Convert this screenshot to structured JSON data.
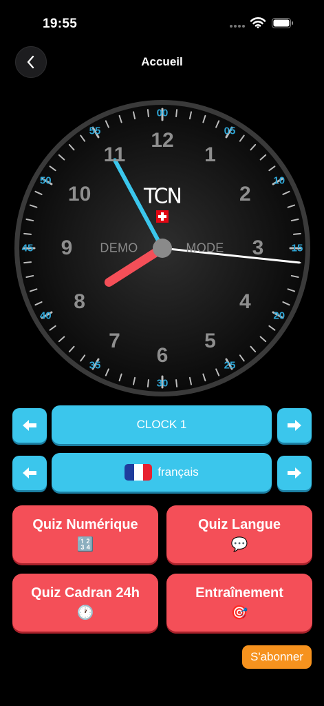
{
  "status_bar": {
    "time": "19:55"
  },
  "nav": {
    "title": "Accueil",
    "back_icon": "chevron-left-icon"
  },
  "clock": {
    "hour_numbers": [
      "12",
      "1",
      "2",
      "3",
      "4",
      "5",
      "6",
      "7",
      "8",
      "9",
      "10",
      "11"
    ],
    "minute_labels": [
      "00",
      "05",
      "10",
      "15",
      "20",
      "25",
      "30",
      "35",
      "40",
      "45",
      "50",
      "55"
    ],
    "logo_text": "TCN",
    "demo_left": "DEMO",
    "demo_right": "MODE",
    "time_shown": {
      "hour": 7,
      "minute": 55,
      "second": 16
    },
    "colors": {
      "hour_hand": "#f44f58",
      "minute_hand": "#3bc6ec",
      "second_hand": "#ffffff",
      "minute_labels": "#2fa6d6"
    }
  },
  "clock_selector": {
    "label": "CLOCK 1",
    "prev_icon": "arrow-left-icon",
    "next_icon": "arrow-right-icon"
  },
  "language_selector": {
    "label": "français",
    "flag": "flag-france-icon",
    "prev_icon": "arrow-left-icon",
    "next_icon": "arrow-right-icon"
  },
  "quizzes": [
    {
      "label": "Quiz Numérique",
      "emoji": "🔢"
    },
    {
      "label": "Quiz Langue",
      "emoji": "💬"
    },
    {
      "label": "Quiz Cadran 24h",
      "emoji": "🕐"
    },
    {
      "label": "Entraînement",
      "emoji": "🎯"
    }
  ],
  "subscribe": {
    "label": "S'abonner"
  },
  "colors": {
    "accent_blue": "#3bc6ec",
    "accent_red": "#f44f58",
    "accent_orange": "#f6921e"
  }
}
